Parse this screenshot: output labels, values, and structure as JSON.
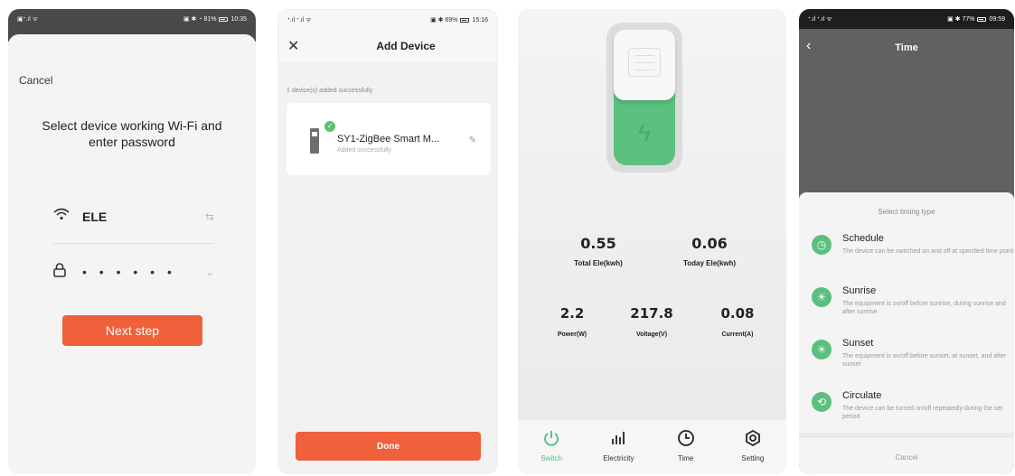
{
  "screen1": {
    "status": {
      "left": "▣ᐩ.ıl ᯤ",
      "right": "▣ ✱ ◔ 81%",
      "time": "10:35"
    },
    "cancel": "Cancel",
    "title": "Select device working Wi-Fi and enter password",
    "ssid": "ELE",
    "password_mask": "• • • • • •",
    "next_button": "Next step",
    "accent": "#f0603a"
  },
  "screen2": {
    "status": {
      "left": "ᐩ.ıl ᐩ.ıl ᯤ",
      "right": "▣ ✱ 69%",
      "time": "15:16"
    },
    "title": "Add Device",
    "added_text": "1 device(s) added successfully",
    "device_name": "SY1-ZigBee Smart M...",
    "device_status": "Added successfully",
    "done_button": "Done"
  },
  "screen3": {
    "stats_top": [
      {
        "value": "0.55",
        "label": "Total Ele(kwh)"
      },
      {
        "value": "0.06",
        "label": "Today Ele(kwh)"
      }
    ],
    "stats_bottom": [
      {
        "value": "2.2",
        "label": "Power(W)"
      },
      {
        "value": "217.8",
        "label": "Voltage(V)"
      },
      {
        "value": "0.08",
        "label": "Current(A)"
      }
    ],
    "tabs": [
      {
        "label": "Switch",
        "icon": "power-icon",
        "active": true
      },
      {
        "label": "Electricity",
        "icon": "bar-chart-icon",
        "active": false
      },
      {
        "label": "Time",
        "icon": "clock-icon",
        "active": false
      },
      {
        "label": "Setting",
        "icon": "settings-icon",
        "active": false
      }
    ],
    "accent": "#4cbf7a"
  },
  "screen4": {
    "status": {
      "left": "ᐩ.ıl ᐩ.ıl ᯤ",
      "right": "▣ ✱ 77%",
      "time": "09:59"
    },
    "title": "Time",
    "sheet_title": "Select timing type",
    "items": [
      {
        "name": "Schedule",
        "desc": "The device can be switched on and off at specified time points",
        "icon": "clock-icon"
      },
      {
        "name": "Sunrise",
        "desc": "The equipment is on/off before sunrise, during sunrise and after sunrise",
        "icon": "sunrise-icon"
      },
      {
        "name": "Sunset",
        "desc": "The equipment is on/off before sunset, at sunset, and after sunset",
        "icon": "sunset-icon"
      },
      {
        "name": "Circulate",
        "desc": "The device can be turned on/off repeatedly during the set period",
        "icon": "loop-icon"
      }
    ],
    "cancel": "Cancel"
  }
}
